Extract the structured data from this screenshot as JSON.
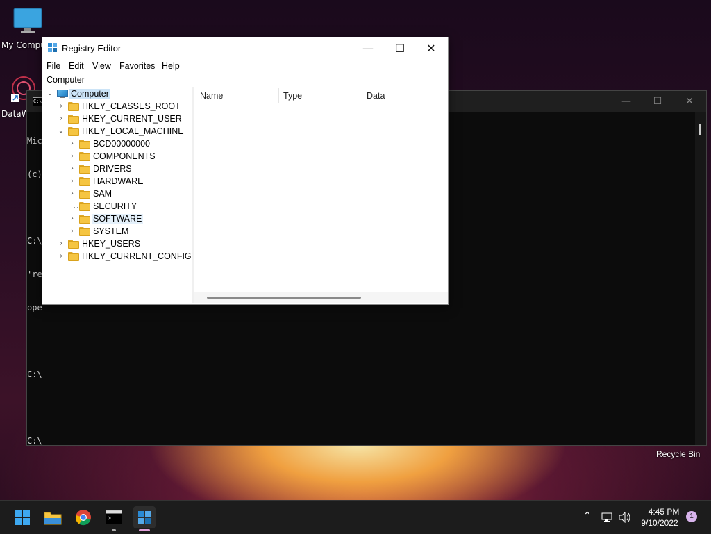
{
  "desktop": {
    "icons": [
      {
        "label": "My Computer"
      },
      {
        "label": "DataW"
      }
    ],
    "recycle_bin": "Recycle Bin"
  },
  "console": {
    "icon_label": "C:\\",
    "lines": [
      "Mic",
      "(c)",
      "",
      "C:\\",
      "'re",
      "ope",
      "",
      "C:\\",
      "",
      "C:\\"
    ]
  },
  "regedit": {
    "title": "Registry Editor",
    "menu": [
      "File",
      "Edit",
      "View",
      "Favorites",
      "Help"
    ],
    "address": "Computer",
    "tree": {
      "root": "Computer",
      "hives": [
        {
          "label": "HKEY_CLASSES_ROOT"
        },
        {
          "label": "HKEY_CURRENT_USER"
        },
        {
          "label": "HKEY_LOCAL_MACHINE"
        },
        {
          "label": "HKEY_USERS"
        },
        {
          "label": "HKEY_CURRENT_CONFIG"
        }
      ],
      "hklm_children": [
        {
          "label": "BCD00000000"
        },
        {
          "label": "COMPONENTS"
        },
        {
          "label": "DRIVERS"
        },
        {
          "label": "HARDWARE"
        },
        {
          "label": "SAM"
        },
        {
          "label": "SECURITY"
        },
        {
          "label": "SOFTWARE"
        },
        {
          "label": "SYSTEM"
        }
      ]
    },
    "columns": [
      "Name",
      "Type",
      "Data"
    ]
  },
  "taskbar": {
    "apps": [
      {
        "icon": "windows-start-icon"
      },
      {
        "icon": "file-explorer-icon"
      },
      {
        "icon": "chrome-icon"
      },
      {
        "icon": "terminal-icon"
      },
      {
        "icon": "registry-editor-icon"
      }
    ],
    "time": "4:45 PM",
    "date": "9/10/2022",
    "notification_count": "1"
  },
  "colors": {
    "accent": "#0078d4",
    "selection": "#cce4f7",
    "folder": "#f5c542"
  }
}
